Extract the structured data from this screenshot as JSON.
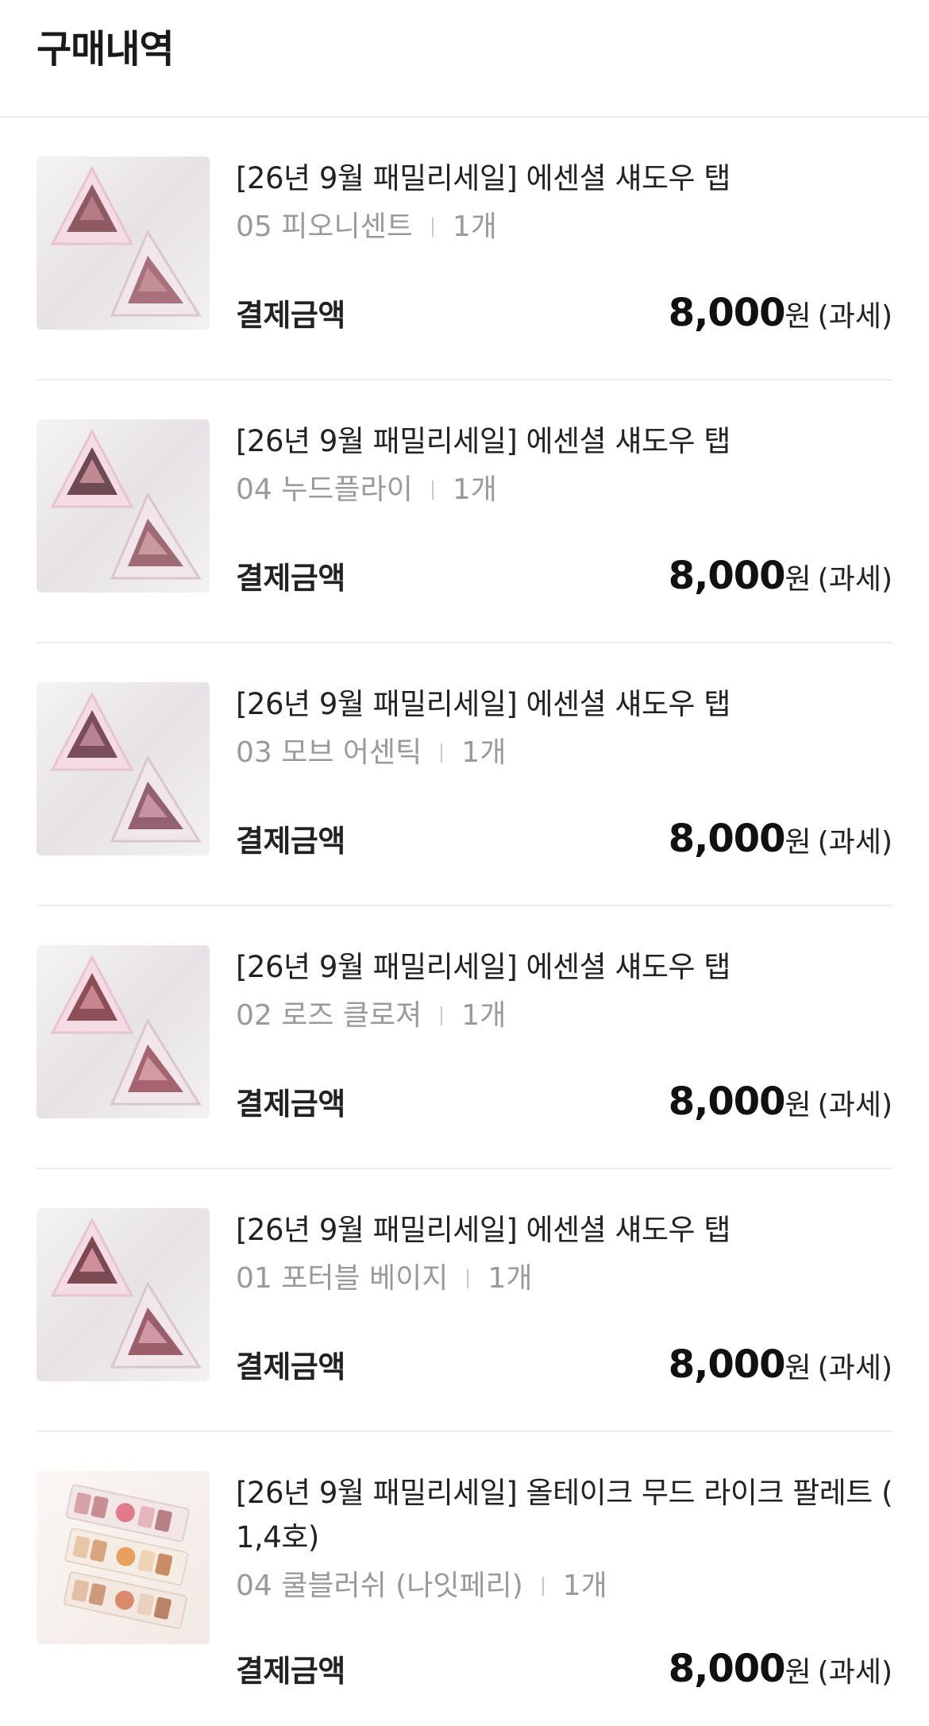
{
  "header": {
    "title": "구매내역"
  },
  "orders": [
    {
      "name": "[26년 9월 패밀리세일] 에센셜 섀도우 탭",
      "option": "05 피오니센트",
      "qty": "1개",
      "pay_label": "결제금액",
      "amount": "8,000",
      "currency": "원",
      "tax": "(과세)",
      "thumb": "shadow"
    },
    {
      "name": "[26년 9월 패밀리세일] 에센셜 섀도우 탭",
      "option": "04 누드플라이",
      "qty": "1개",
      "pay_label": "결제금액",
      "amount": "8,000",
      "currency": "원",
      "tax": "(과세)",
      "thumb": "shadow"
    },
    {
      "name": "[26년 9월 패밀리세일] 에센셜 섀도우 탭",
      "option": "03 모브 어센틱",
      "qty": "1개",
      "pay_label": "결제금액",
      "amount": "8,000",
      "currency": "원",
      "tax": "(과세)",
      "thumb": "shadow"
    },
    {
      "name": "[26년 9월 패밀리세일] 에센셜 섀도우 탭",
      "option": "02 로즈 클로져",
      "qty": "1개",
      "pay_label": "결제금액",
      "amount": "8,000",
      "currency": "원",
      "tax": "(과세)",
      "thumb": "shadow"
    },
    {
      "name": "[26년 9월 패밀리세일] 에센셜 섀도우 탭",
      "option": "01 포터블 베이지",
      "qty": "1개",
      "pay_label": "결제금액",
      "amount": "8,000",
      "currency": "원",
      "tax": "(과세)",
      "thumb": "shadow"
    },
    {
      "name": "[26년 9월 패밀리세일] 올테이크 무드 라이크 팔레트 (",
      "name_line2": "1,4호)",
      "option": "04 쿨블러쉬 (나잇페리)",
      "qty": "1개",
      "pay_label": "결제금액",
      "amount": "8,000",
      "currency": "원",
      "tax": "(과세)",
      "thumb": "palette"
    }
  ]
}
